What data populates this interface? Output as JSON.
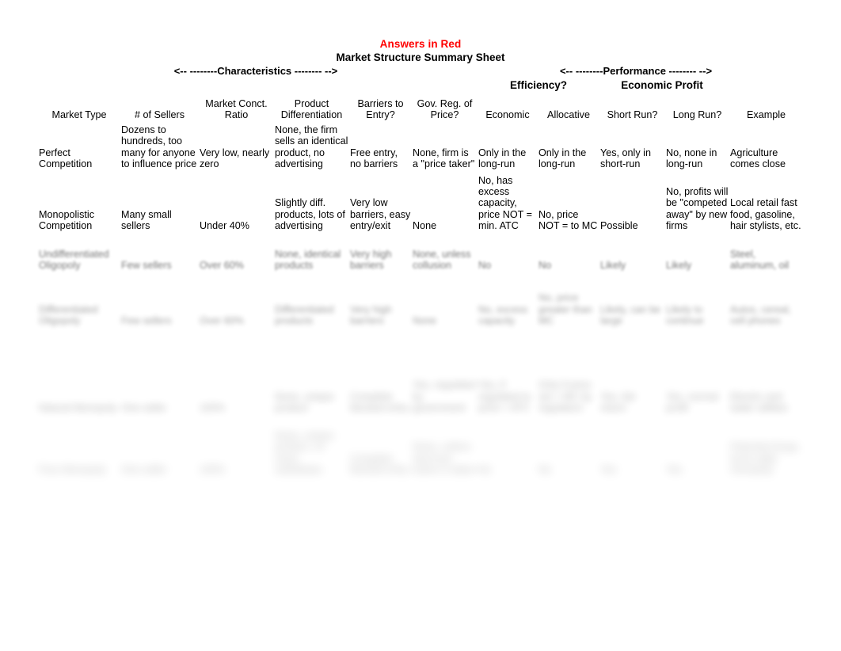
{
  "page": {
    "answers_note": "Answers in Red",
    "title": "Market Structure Summary Sheet",
    "characteristics_band": "<-- --------Characteristics -------- -->",
    "performance_band": "<-- --------Performance -------- -->",
    "efficiency_band": "Efficiency?",
    "economic_profit_band": "Economic Profit",
    "answer_color": "#ff1111",
    "text_color": "#000000"
  },
  "table": {
    "headers": [
      "Market Type",
      "# of Sellers",
      "Market Conct. Ratio",
      "Product Differentiation",
      "Barriers to Entry?",
      "Gov. Reg. of Price?",
      "Economic",
      "Allocative",
      "Short Run?",
      "Long Run?",
      "Example"
    ],
    "headers_split": [
      [
        "Market Type",
        ""
      ],
      [
        "# of Sellers",
        ""
      ],
      [
        "Market Conct.",
        "Ratio"
      ],
      [
        "Product",
        "Differentiation"
      ],
      [
        "Barriers to",
        "Entry?"
      ],
      [
        "Gov. Reg. of",
        "Price?"
      ],
      [
        "Economic",
        ""
      ],
      [
        "Allocative",
        ""
      ],
      [
        "Short Run?",
        ""
      ],
      [
        "Long Run?",
        ""
      ],
      [
        "Example",
        ""
      ]
    ],
    "rows": [
      {
        "market_type": "Perfect Competition",
        "sellers": "Dozens to hundreds, too many for anyone to influence price",
        "sellers_red": false,
        "conct_ratio": "Very low, nearly zero",
        "conct_ratio_red": true,
        "product_diff": "None, the firm sells an identical product, no advertising",
        "product_diff_red": false,
        "barriers": "Free entry, no barriers",
        "barriers_red": true,
        "gov_reg": "None, firm is a \"price taker\"",
        "gov_reg_red": false,
        "economic": "Only in the long-run",
        "economic_red": true,
        "allocative": "Only in the long-run",
        "allocative_red": true,
        "short_run": "Yes, only in short-run",
        "short_run_red": false,
        "long_run": "No, none in long-run",
        "long_run_red": true,
        "example": "Agriculture comes close",
        "example_red": false,
        "blur": 0
      },
      {
        "market_type": "Monopolistic Competition",
        "sellers": "Many small sellers",
        "sellers_red": false,
        "conct_ratio": "Under 40%",
        "conct_ratio_red": true,
        "product_diff": "Slightly diff. products, lots of advertising",
        "product_diff_red": true,
        "barriers": "Very low barriers, easy entry/exit",
        "barriers_red": false,
        "gov_reg": "None",
        "gov_reg_red": true,
        "economic": "No, has excess capacity, price NOT = min. ATC",
        "economic_red": true,
        "allocative": "No, price NOT = to MC",
        "allocative_red": true,
        "short_run": "Possible",
        "short_run_red": true,
        "long_run": "No, profits will be \"competed away\" by new firms",
        "long_run_red": false,
        "example": "Local retail fast food, gasoline, hair stylists, etc.",
        "example_red": false,
        "blur": 0
      },
      {
        "market_type": "Undifferentiated Oligopoly",
        "sellers": "Few sellers",
        "sellers_red": false,
        "conct_ratio": "Over 60%",
        "conct_ratio_red": true,
        "product_diff": "None, identical products",
        "product_diff_red": true,
        "barriers": "Very high barriers",
        "barriers_red": true,
        "gov_reg": "None, unless collusion",
        "gov_reg_red": false,
        "economic": "No",
        "economic_red": true,
        "allocative": "No",
        "allocative_red": true,
        "short_run": "Likely",
        "short_run_red": true,
        "long_run": "Likely",
        "long_run_red": true,
        "example": "Steel, aluminum, oil",
        "example_red": false,
        "blur": 1
      },
      {
        "market_type": "Differentiated Oligopoly",
        "sellers": "Few sellers",
        "sellers_red": false,
        "conct_ratio": "Over 60%",
        "conct_ratio_red": true,
        "product_diff": "Differentiated products",
        "product_diff_red": true,
        "barriers": "Very high barriers",
        "barriers_red": true,
        "gov_reg": "None",
        "gov_reg_red": true,
        "economic": "No, excess capacity",
        "economic_red": false,
        "allocative": "No, price greater than MC",
        "allocative_red": true,
        "short_run": "Likely, can be large",
        "short_run_red": true,
        "long_run": "Likely to continue",
        "long_run_red": true,
        "example": "Autos, cereal, cell phones",
        "example_red": false,
        "blur": 2
      },
      {
        "market_type": "Natural Monopoly",
        "sellers": "One seller",
        "sellers_red": false,
        "conct_ratio": "100%",
        "conct_ratio_red": true,
        "product_diff": "None, unique product",
        "product_diff_red": true,
        "barriers": "Complete blocked entry",
        "barriers_red": true,
        "gov_reg": "Yes, regulated by government",
        "gov_reg_red": false,
        "economic": "Yes, if regulated to price = ATC",
        "economic_red": true,
        "allocative": "Only if price set = MC by regulators",
        "allocative_red": false,
        "short_run": "Yes, fair return",
        "short_run_red": true,
        "long_run": "Yes, normal profit",
        "long_run_red": true,
        "example": "Electric and water utilities",
        "example_red": false,
        "blur": 3
      },
      {
        "market_type": "Pure Monopoly",
        "sellers": "One seller",
        "sellers_red": false,
        "conct_ratio": "100%",
        "conct_ratio_red": true,
        "product_diff": "None, unique product, no close substitutes",
        "product_diff_red": true,
        "barriers": "Complete blocked entry",
        "barriers_red": true,
        "gov_reg": "None, unless anti-trust action is taken",
        "gov_reg_red": false,
        "economic": "No",
        "economic_red": true,
        "allocative": "No",
        "allocative_red": true,
        "short_run": "Yes",
        "short_run_red": true,
        "long_run": "Yes",
        "long_run_red": true,
        "example": "Patented drugs, local cable monopoly",
        "example_red": false,
        "blur": 4
      }
    ]
  }
}
